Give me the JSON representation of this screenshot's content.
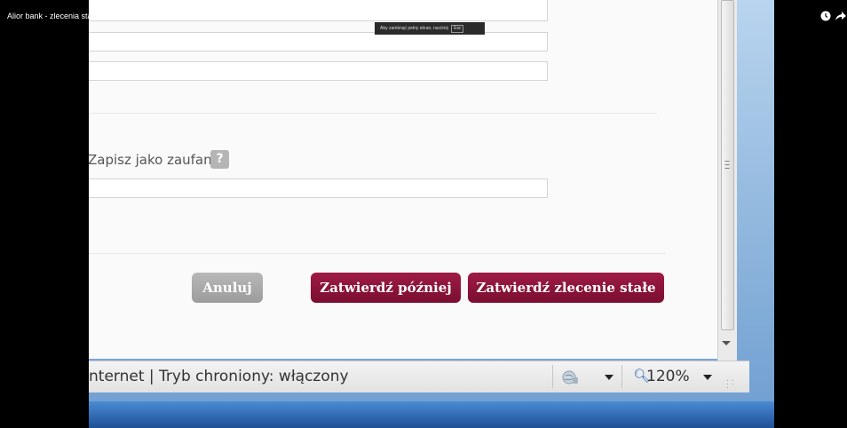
{
  "video": {
    "title": "Alior bank - zlecenia stałe.",
    "fullscreen_hint": "Aby zamknąć pełny ekran, naciśnij",
    "esc_key": "Esc"
  },
  "form": {
    "trusted_label": "Zapisz jako zaufany",
    "help_badge": "?"
  },
  "buttons": {
    "cancel": "Anuluj",
    "confirm_later": "Zatwierdź później",
    "confirm_standing_order": "Zatwierdź zlecenie stałe"
  },
  "statusbar": {
    "zone_text": "nternet | Tryb chroniony: włączony",
    "zoom": "120%"
  },
  "icons": {
    "help": "help-icon",
    "globe": "security-zone-icon",
    "zoom": "magnifier-icon",
    "clock": "watch-later-icon",
    "share": "share-icon"
  },
  "colors": {
    "primary_button": "#8a1339",
    "secondary_button": "#a8a8a8",
    "help_badge": "#b5b5b5"
  }
}
